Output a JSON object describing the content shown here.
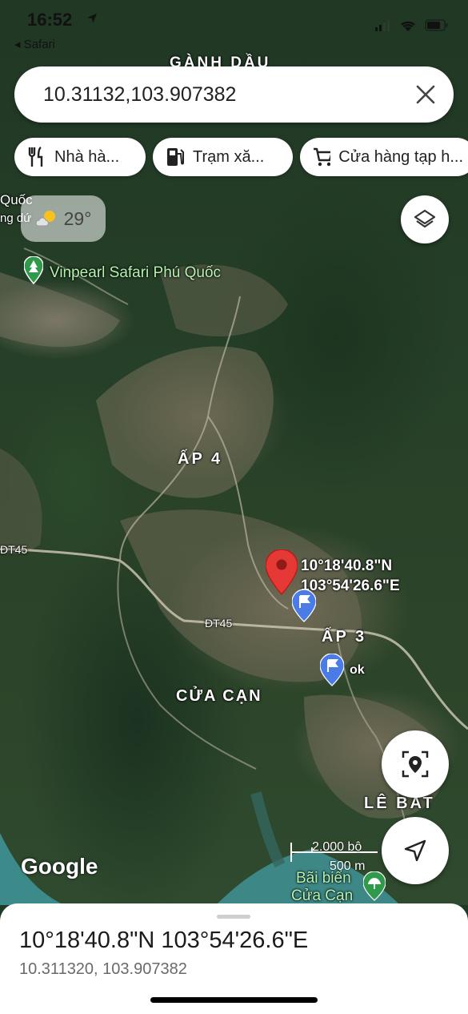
{
  "status": {
    "time": "16:52",
    "back_app": "Safari"
  },
  "search": {
    "query": "10.31132,103.907382",
    "close_icon": "close-icon"
  },
  "chips": [
    {
      "label": "Nhà hà...",
      "icon": "restaurant-icon"
    },
    {
      "label": "Trạm xă...",
      "icon": "gas-station-icon"
    },
    {
      "label": "Cửa hàng tạp h...",
      "icon": "shopping-cart-icon"
    }
  ],
  "weather": {
    "temperature": "29°",
    "icon": "partly-cloudy-icon"
  },
  "map": {
    "area_labels": {
      "ganh_dau": "GÀNH DẦU",
      "ap4": "ẤP 4",
      "ap3": "ẤP 3",
      "cua_can": "CỬA CẠN",
      "le_bat": "LÊ BAT"
    },
    "poi": {
      "safari": "Vinpearl Safari Phú Quốc",
      "safari_left_1": "Quốc",
      "safari_left_2": "ng dứ",
      "beach_1": "Bãi biển",
      "beach_2": "Cửa Cạn"
    },
    "roads": {
      "dt45_left": "ĐT45",
      "dt45_mid": "ĐT45"
    },
    "pin": {
      "lat": "10°18'40.8\"N",
      "lng": "103°54'26.6\"E"
    },
    "saved_place_label": "ok",
    "scale": {
      "imperial": "2.000 bộ",
      "metric": "500 m"
    },
    "attribution": "Google"
  },
  "sheet": {
    "title": "10°18'40.8\"N 103°54'26.6\"E",
    "subtitle": "10.311320, 103.907382"
  }
}
